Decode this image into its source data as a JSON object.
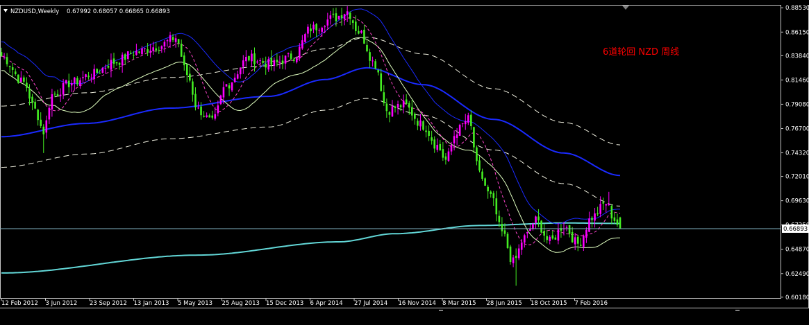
{
  "window": {
    "symbol_title": "NZDUSD,Weekly",
    "ohlc_text": "0.67992 0.68057 0.66865 0.66893"
  },
  "annotation": "6道轮回 NZD 周线",
  "colors": {
    "background": "#000000",
    "axis": "#c8c8c8",
    "bull_candle": "#ff00ff",
    "bear_candle": "#44ee22",
    "ma_blue": "#1a2aff",
    "ma_long": "#62d6d6",
    "envelope": "#f0f0e0",
    "inner_ma": "#e0ffc0",
    "dashed_ma": "#ff44cc",
    "annotation_text": "#ff0000",
    "price_line": "#7fb0c0",
    "price_tag_bg": "#ffffff",
    "price_tag_text": "#000000"
  },
  "chart_data": {
    "type": "candlestick",
    "symbol": "NZDUSD",
    "timeframe": "Weekly",
    "current_price": "0.66893",
    "ylim": [
      0.601,
      0.8875
    ],
    "y_ticks": [
      "0.88530",
      "0.86150",
      "0.83840",
      "0.81460",
      "0.79080",
      "0.76700",
      "0.74320",
      "0.72010",
      "0.69630",
      "0.67250",
      "0.64870",
      "0.62490",
      "0.60180"
    ],
    "x_ticks": [
      "12 Feb 2012",
      "3 Jun 2012",
      "23 Sep 2012",
      "13 Jan 2013",
      "5 May 2013",
      "25 Aug 2013",
      "15 Dec 2013",
      "6 Apr 2014",
      "27 Jul 2014",
      "16 Nov 2014",
      "8 Mar 2015",
      "28 Jun 2015",
      "18 Oct 2015",
      "7 Feb 2016"
    ],
    "close_anchors": [
      [
        0,
        0.838
      ],
      [
        8,
        0.812
      ],
      [
        12,
        0.785
      ],
      [
        15,
        0.764
      ],
      [
        18,
        0.8
      ],
      [
        25,
        0.812
      ],
      [
        32,
        0.82
      ],
      [
        40,
        0.832
      ],
      [
        48,
        0.842
      ],
      [
        56,
        0.848
      ],
      [
        62,
        0.856
      ],
      [
        66,
        0.82
      ],
      [
        70,
        0.785
      ],
      [
        75,
        0.773
      ],
      [
        80,
        0.81
      ],
      [
        88,
        0.836
      ],
      [
        96,
        0.83
      ],
      [
        104,
        0.838
      ],
      [
        110,
        0.865
      ],
      [
        118,
        0.875
      ],
      [
        123,
        0.882
      ],
      [
        127,
        0.862
      ],
      [
        133,
        0.83
      ],
      [
        137,
        0.785
      ],
      [
        143,
        0.79
      ],
      [
        150,
        0.77
      ],
      [
        155,
        0.75
      ],
      [
        158,
        0.736
      ],
      [
        162,
        0.765
      ],
      [
        166,
        0.776
      ],
      [
        170,
        0.722
      ],
      [
        174,
        0.7
      ],
      [
        178,
        0.665
      ],
      [
        182,
        0.636
      ],
      [
        186,
        0.66
      ],
      [
        190,
        0.677
      ],
      [
        195,
        0.656
      ],
      [
        200,
        0.672
      ],
      [
        205,
        0.654
      ],
      [
        210,
        0.68
      ],
      [
        215,
        0.694
      ],
      [
        218,
        0.678
      ],
      [
        220,
        0.669
      ]
    ],
    "indicators": {
      "long_ma_anchors": [
        [
          0,
          0.6255
        ],
        [
          70,
          0.643
        ],
        [
          120,
          0.656
        ],
        [
          140,
          0.664
        ],
        [
          170,
          0.672
        ],
        [
          200,
          0.6745
        ],
        [
          220,
          0.674
        ]
      ],
      "blue_ma_anchors": [
        [
          0,
          0.759
        ],
        [
          30,
          0.772
        ],
        [
          60,
          0.787
        ],
        [
          95,
          0.7985
        ],
        [
          115,
          0.815
        ],
        [
          130,
          0.8265
        ],
        [
          150,
          0.81
        ],
        [
          175,
          0.776
        ],
        [
          200,
          0.743
        ],
        [
          220,
          0.721
        ]
      ]
    }
  }
}
